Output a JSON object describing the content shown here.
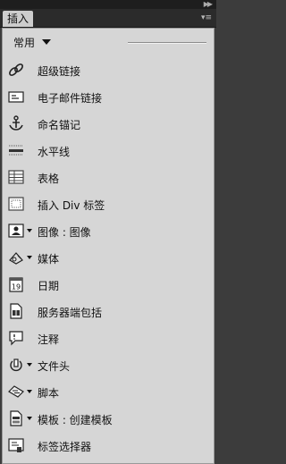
{
  "panel": {
    "tab_label": "插入",
    "category": "常用"
  },
  "items": [
    {
      "label": "超级链接",
      "icon": "hyperlink-icon",
      "dropdown": false
    },
    {
      "label": "电子邮件链接",
      "icon": "email-link-icon",
      "dropdown": false
    },
    {
      "label": "命名锚记",
      "icon": "named-anchor-icon",
      "dropdown": false
    },
    {
      "label": "水平线",
      "icon": "horizontal-rule-icon",
      "dropdown": false
    },
    {
      "label": "表格",
      "icon": "table-icon",
      "dropdown": false
    },
    {
      "label": "插入 Div 标签",
      "icon": "div-tag-icon",
      "dropdown": false
    },
    {
      "label": "图像 : 图像",
      "icon": "image-icon",
      "dropdown": true
    },
    {
      "label": "媒体",
      "icon": "media-icon",
      "dropdown": true
    },
    {
      "label": "日期",
      "icon": "date-icon",
      "dropdown": false
    },
    {
      "label": "服务器端包括",
      "icon": "server-include-icon",
      "dropdown": false
    },
    {
      "label": "注释",
      "icon": "comment-icon",
      "dropdown": false
    },
    {
      "label": "文件头",
      "icon": "head-icon",
      "dropdown": true
    },
    {
      "label": "脚本",
      "icon": "script-icon",
      "dropdown": true
    },
    {
      "label": "模板 : 创建模板",
      "icon": "template-icon",
      "dropdown": true
    },
    {
      "label": "标签选择器",
      "icon": "tag-chooser-icon",
      "dropdown": false
    }
  ]
}
